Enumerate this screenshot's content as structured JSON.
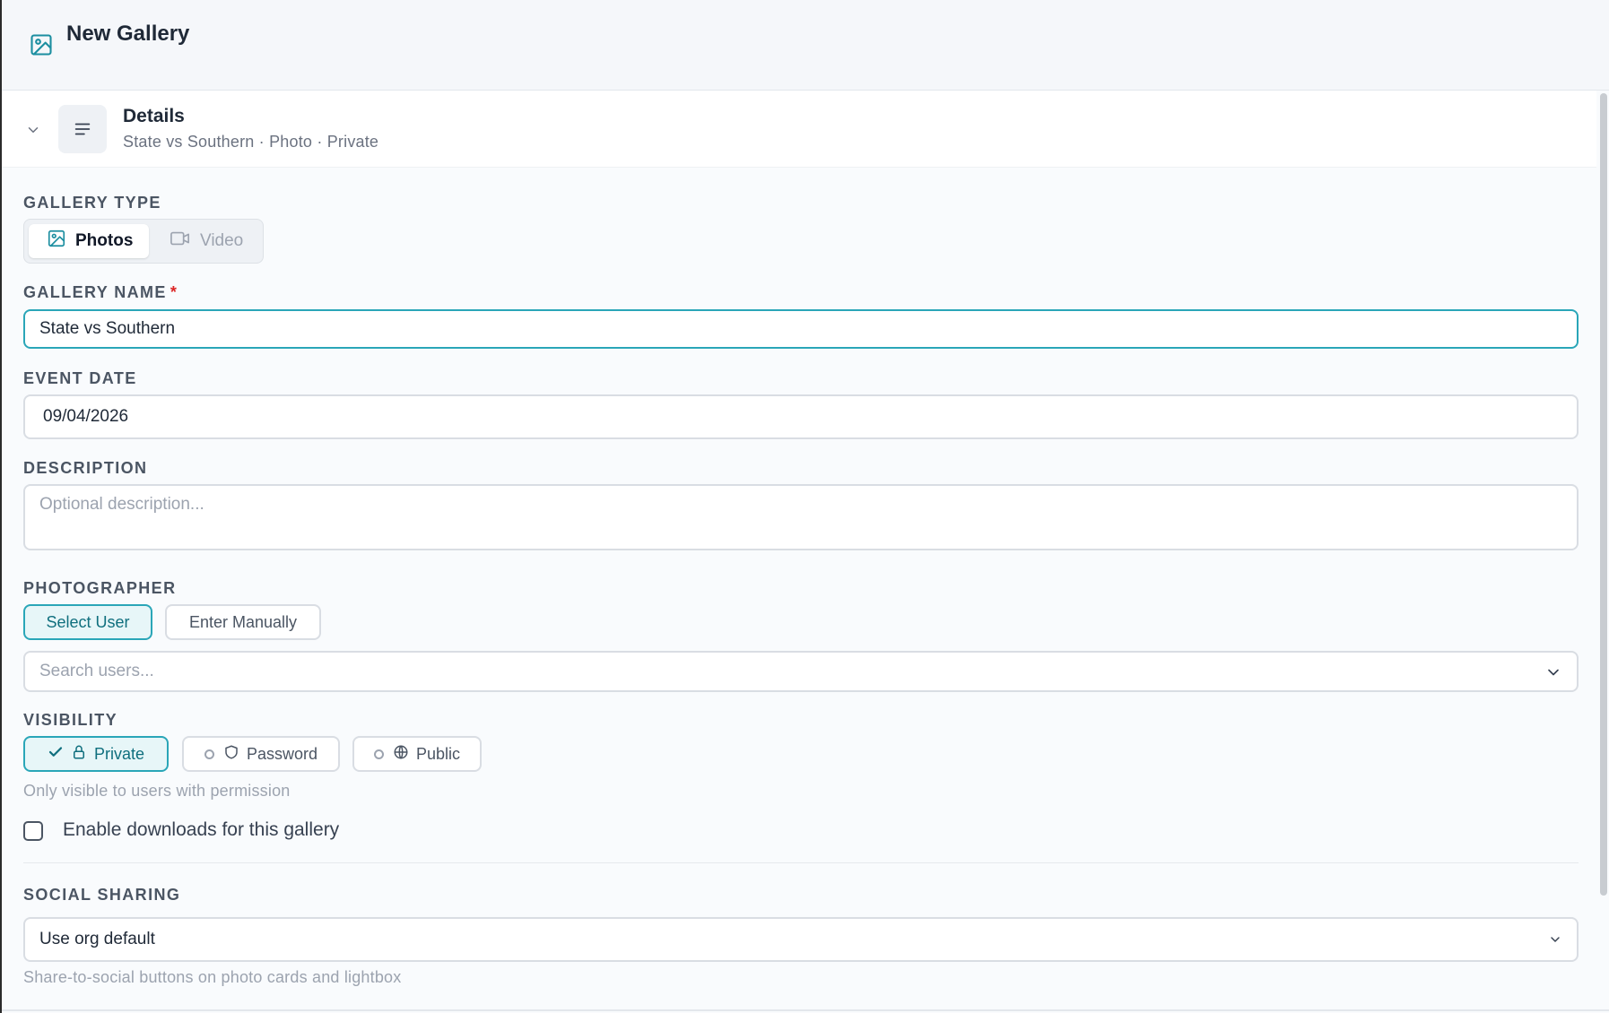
{
  "header": {
    "title": "New Gallery",
    "icon": "image-icon"
  },
  "details": {
    "title": "Details",
    "subtitle": "State vs Southern · Photo · Private"
  },
  "gallery_type": {
    "label": "GALLERY TYPE",
    "options": [
      {
        "label": "Photos",
        "icon": "image-icon",
        "selected": true
      },
      {
        "label": "Video",
        "icon": "video-icon",
        "selected": false
      }
    ]
  },
  "gallery_name": {
    "label": "GALLERY NAME",
    "required_mark": "*",
    "value": "State vs Southern"
  },
  "event_date": {
    "label": "EVENT DATE",
    "value": "09/04/2026"
  },
  "description": {
    "label": "DESCRIPTION",
    "placeholder": "Optional description..."
  },
  "photographer": {
    "label": "PHOTOGRAPHER",
    "modes": [
      {
        "label": "Select User",
        "selected": true
      },
      {
        "label": "Enter Manually",
        "selected": false
      }
    ],
    "search_placeholder": "Search users..."
  },
  "visibility": {
    "label": "VISIBILITY",
    "options": [
      {
        "label": "Private",
        "icon": "lock-icon",
        "selected": true
      },
      {
        "label": "Password",
        "icon": "shield-icon",
        "selected": false
      },
      {
        "label": "Public",
        "icon": "globe-icon",
        "selected": false
      }
    ],
    "helper": "Only visible to users with permission"
  },
  "downloads": {
    "label": "Enable downloads for this gallery",
    "checked": false
  },
  "social_sharing": {
    "label": "SOCIAL SHARING",
    "value": "Use org default",
    "helper": "Share-to-social buttons on photo cards and lightbox"
  },
  "colors": {
    "accent": "#2aa6b8",
    "required": "#dc2626"
  }
}
